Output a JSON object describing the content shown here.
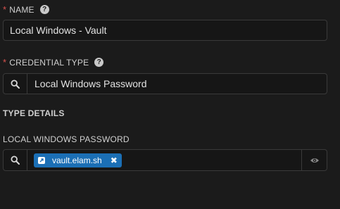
{
  "name_field": {
    "required_marker": "*",
    "label": "NAME",
    "help_glyph": "?",
    "value": "Local Windows - Vault"
  },
  "credential_type_field": {
    "required_marker": "*",
    "label": "CREDENTIAL TYPE",
    "help_glyph": "?",
    "value": "Local Windows Password"
  },
  "type_details": {
    "title": "TYPE DETAILS"
  },
  "password_field": {
    "label": "LOCAL WINDOWS PASSWORD",
    "chip": {
      "label": "vault.elam.sh",
      "remove_glyph": "✖"
    }
  },
  "icons": {
    "search": "search-icon",
    "help": "help-icon",
    "eye": "eye-icon",
    "external-link": "external-link-icon"
  },
  "colors": {
    "background": "#1b1b1b",
    "required": "#d9534f",
    "chip": "#1b6fb5",
    "border": "#3a3a3a"
  }
}
